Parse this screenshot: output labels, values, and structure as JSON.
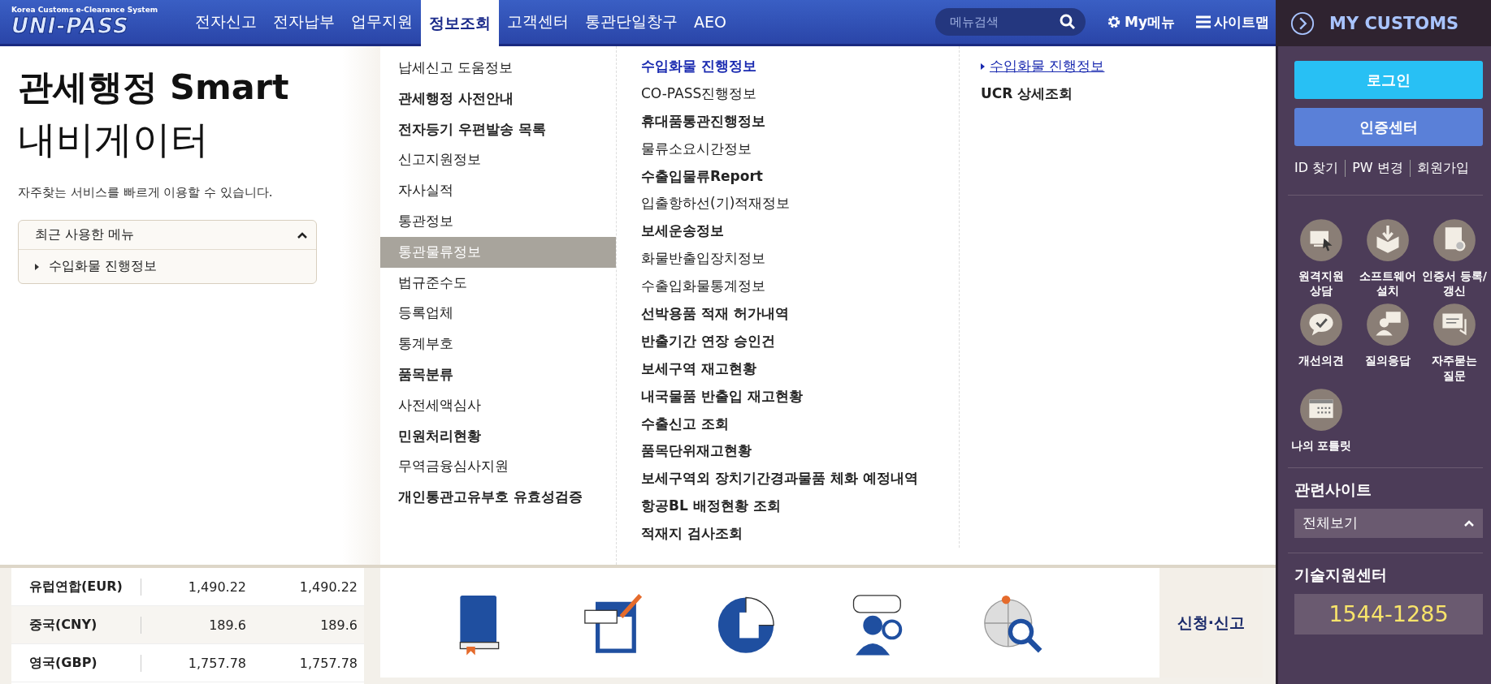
{
  "header": {
    "logo_caption": "Korea Customs e-Clearance System",
    "logo": "UNI-PASS",
    "tabs": [
      {
        "label": "전자신고",
        "selected": false
      },
      {
        "label": "전자납부",
        "selected": false
      },
      {
        "label": "업무지원",
        "selected": false
      },
      {
        "label": "정보조회",
        "selected": true
      },
      {
        "label": "고객센터",
        "selected": false
      },
      {
        "label": "통관단일창구",
        "selected": false
      },
      {
        "label": "AEO",
        "selected": false
      }
    ],
    "search": {
      "placeholder": "메뉴검색"
    },
    "my_menu": "My메뉴",
    "sitemap": "사이트맵"
  },
  "navigator": {
    "title_bold": "관세행정 Smart",
    "title": "내비게이터",
    "description": "자주찾는 서비스를 빠르게 이용할 수 있습니다.",
    "recent": {
      "title": "최근 사용한 메뉴",
      "expanded": true,
      "items": [
        "수입화물 진행정보"
      ]
    }
  },
  "menu_column_1": [
    {
      "label": "납세신고 도움정보",
      "bold": false,
      "selected": false
    },
    {
      "label": "관세행정 사전안내",
      "bold": true,
      "selected": false
    },
    {
      "label": "전자등기 우편발송 목록",
      "bold": true,
      "selected": false
    },
    {
      "label": "신고지원정보",
      "bold": false,
      "selected": false
    },
    {
      "label": "자사실적",
      "bold": false,
      "selected": false
    },
    {
      "label": "통관정보",
      "bold": false,
      "selected": false
    },
    {
      "label": "통관물류정보",
      "bold": false,
      "selected": true
    },
    {
      "label": "법규준수도",
      "bold": false,
      "selected": false
    },
    {
      "label": "등록업체",
      "bold": false,
      "selected": false
    },
    {
      "label": "통계부호",
      "bold": false,
      "selected": false
    },
    {
      "label": "품목분류",
      "bold": true,
      "selected": false
    },
    {
      "label": "사전세액심사",
      "bold": false,
      "selected": false
    },
    {
      "label": "민원처리현황",
      "bold": true,
      "selected": false
    },
    {
      "label": "무역금융심사지원",
      "bold": false,
      "selected": false
    },
    {
      "label": "개인통관고유부호 유효성검증",
      "bold": true,
      "selected": false
    }
  ],
  "menu_column_2": [
    {
      "label": "수입화물 진행정보",
      "bold": true,
      "selected": true
    },
    {
      "label": "CO-PASS진행정보",
      "bold": false,
      "selected": false
    },
    {
      "label": "휴대품통관진행정보",
      "bold": true,
      "selected": false
    },
    {
      "label": "물류소요시간정보",
      "bold": false,
      "selected": false
    },
    {
      "label": "수출입물류Report",
      "bold": true,
      "selected": false
    },
    {
      "label": "입출항하선(기)적재정보",
      "bold": false,
      "selected": false
    },
    {
      "label": "보세운송정보",
      "bold": true,
      "selected": false
    },
    {
      "label": "화물반출입장치정보",
      "bold": false,
      "selected": false
    },
    {
      "label": "수출입화물통계정보",
      "bold": false,
      "selected": false
    },
    {
      "label": "선박용품 적재 허가내역",
      "bold": true,
      "selected": false
    },
    {
      "label": "반출기간 연장 승인건",
      "bold": true,
      "selected": false
    },
    {
      "label": "보세구역 재고현황",
      "bold": true,
      "selected": false
    },
    {
      "label": "내국물품 반출입 재고현황",
      "bold": true,
      "selected": false
    },
    {
      "label": "수출신고 조회",
      "bold": true,
      "selected": false
    },
    {
      "label": "품목단위재고현황",
      "bold": true,
      "selected": false
    },
    {
      "label": "보세구역외 장치기간경과물품 체화 예정내역",
      "bold": true,
      "selected": false
    },
    {
      "label": "항공BL 배정현황 조회",
      "bold": true,
      "selected": false
    },
    {
      "label": "적재지 검사조회",
      "bold": true,
      "selected": false
    }
  ],
  "menu_column_3": [
    {
      "label": "수입화물 진행정보",
      "bold": false,
      "selected": true
    },
    {
      "label": "UCR 상세조회",
      "bold": true,
      "selected": false
    }
  ],
  "exchange_rates": [
    {
      "currency": "유럽연합(EUR)",
      "column_2": "1,490.22",
      "column_3": "1,490.22"
    },
    {
      "currency": "중국(CNY)",
      "column_2": "189.6",
      "column_3": "189.6"
    },
    {
      "currency": "영국(GBP)",
      "column_2": "1,757.78",
      "column_3": "1,757.78"
    }
  ],
  "services_strip": {
    "label": "신청·신고"
  },
  "sidebar": {
    "title": "MY CUSTOMS",
    "login": "로그인",
    "cert_center": "인증센터",
    "links": [
      "ID 찾기",
      "PW 변경",
      "회원가입"
    ],
    "services": [
      {
        "label": "원격지원 상담",
        "kind": "monitor"
      },
      {
        "label": "소프트웨어 설치",
        "kind": "box"
      },
      {
        "label": "인증서 등록/갱신",
        "kind": "certificate"
      },
      {
        "label": "개선의견",
        "kind": "chat"
      },
      {
        "label": "질의응답",
        "kind": "person"
      },
      {
        "label": "자주묻는 질문",
        "kind": "message"
      },
      {
        "label": "나의 포틀릿",
        "kind": "calendar"
      }
    ],
    "related_title": "관련사이트",
    "related_select": "전체보기",
    "support_title": "기술지원센터",
    "support_phone": "1544-1285"
  }
}
